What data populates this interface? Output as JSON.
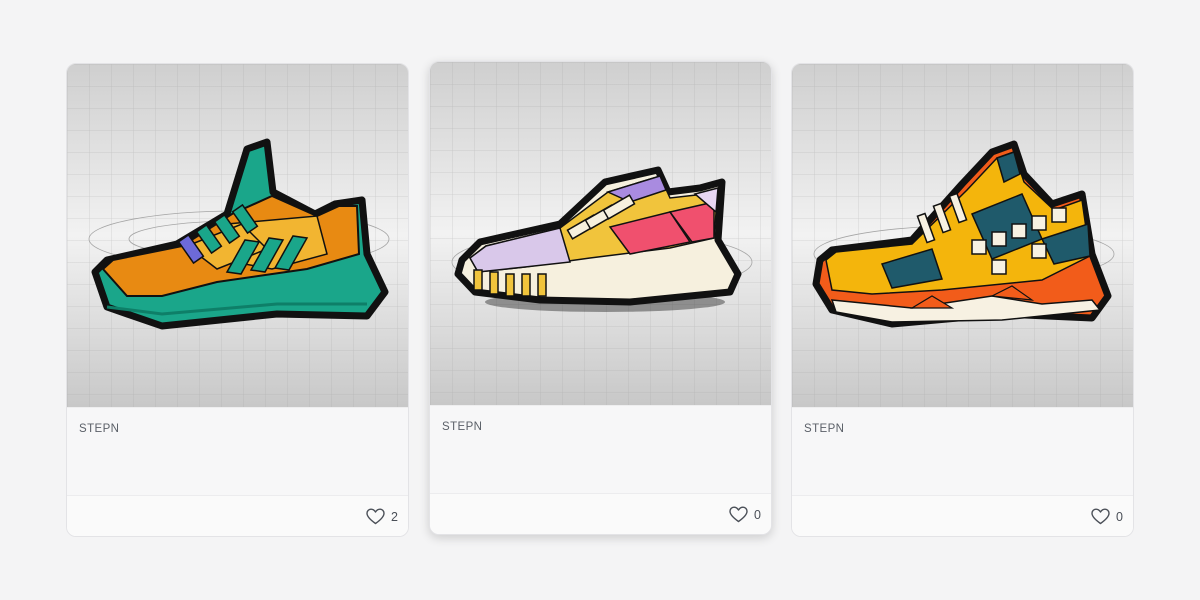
{
  "cards": [
    {
      "collection": "STEPN",
      "likes": "2",
      "icon": "heart-icon",
      "palette": [
        "#e88a12",
        "#1aa68a",
        "#6d6ad8",
        "#f2b531"
      ]
    },
    {
      "collection": "STEPN",
      "likes": "0",
      "icon": "heart-icon",
      "palette": [
        "#f1c43c",
        "#f0506e",
        "#a98be0",
        "#f6f0de"
      ]
    },
    {
      "collection": "STEPN",
      "likes": "0",
      "icon": "heart-icon",
      "palette": [
        "#f4b50c",
        "#f25c1a",
        "#1f5a6b",
        "#f7f1e2"
      ]
    }
  ]
}
